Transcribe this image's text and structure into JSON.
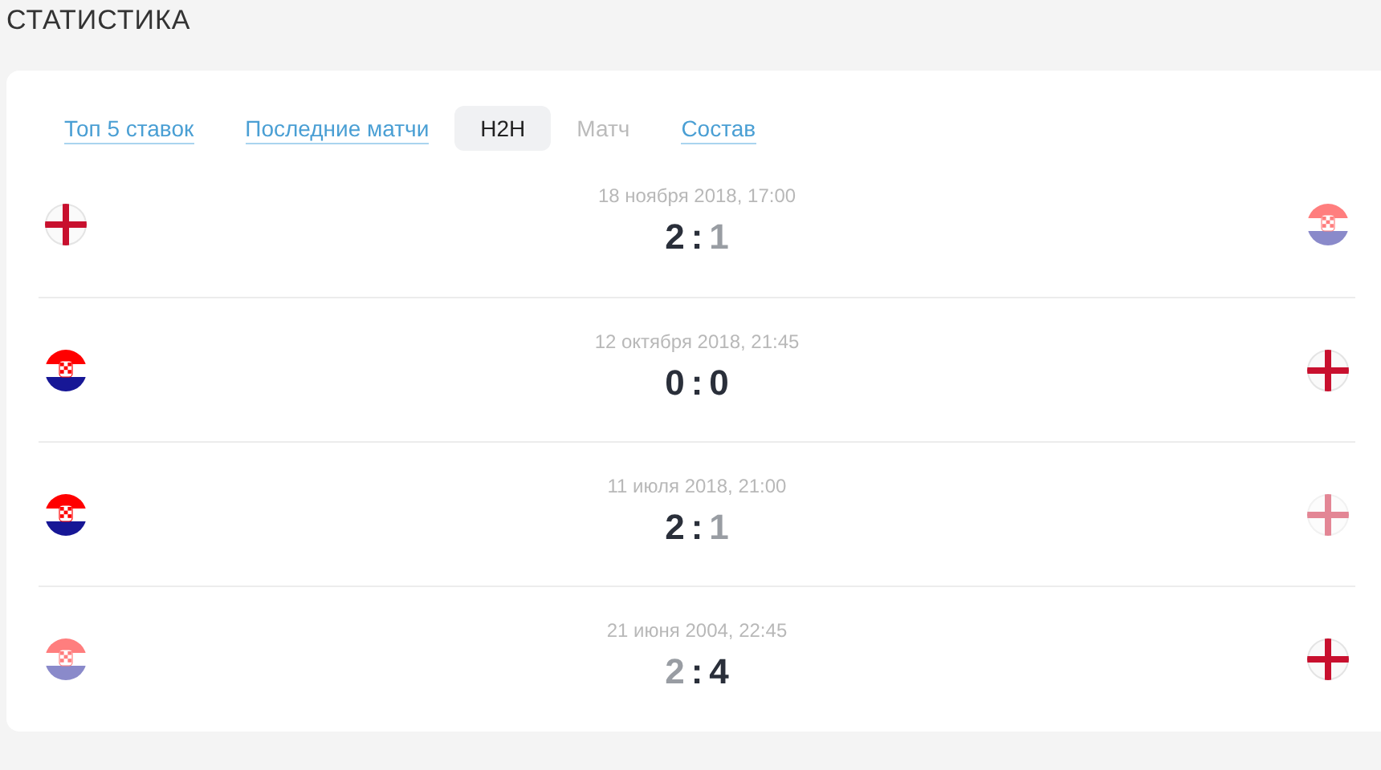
{
  "title": "СТАТИСТИКА",
  "tabs": [
    {
      "label": "Топ 5 ставок",
      "selected": false,
      "disabled": false
    },
    {
      "label": "Последние матчи",
      "selected": false,
      "disabled": false
    },
    {
      "label": "H2H",
      "selected": true,
      "disabled": false
    },
    {
      "label": "Матч",
      "selected": false,
      "disabled": true
    },
    {
      "label": "Состав",
      "selected": false,
      "disabled": false
    }
  ],
  "matches": [
    {
      "date": "18 ноября 2018, 17:00",
      "separator": ":",
      "home": {
        "kind": "cross",
        "score": "2",
        "lost": false
      },
      "away": {
        "kind": "stripes",
        "score": "1",
        "lost": true
      }
    },
    {
      "date": "12 октября 2018, 21:45",
      "separator": ":",
      "home": {
        "kind": "stripes",
        "score": "0",
        "lost": false
      },
      "away": {
        "kind": "cross",
        "score": "0",
        "lost": false
      }
    },
    {
      "date": "11 июля 2018, 21:00",
      "separator": ":",
      "home": {
        "kind": "stripes",
        "score": "2",
        "lost": false
      },
      "away": {
        "kind": "cross",
        "score": "1",
        "lost": true
      }
    },
    {
      "date": "21 июня 2004, 22:45",
      "separator": ":",
      "home": {
        "kind": "stripes",
        "score": "2",
        "lost": true
      },
      "away": {
        "kind": "cross",
        "score": "4",
        "lost": false
      }
    }
  ]
}
